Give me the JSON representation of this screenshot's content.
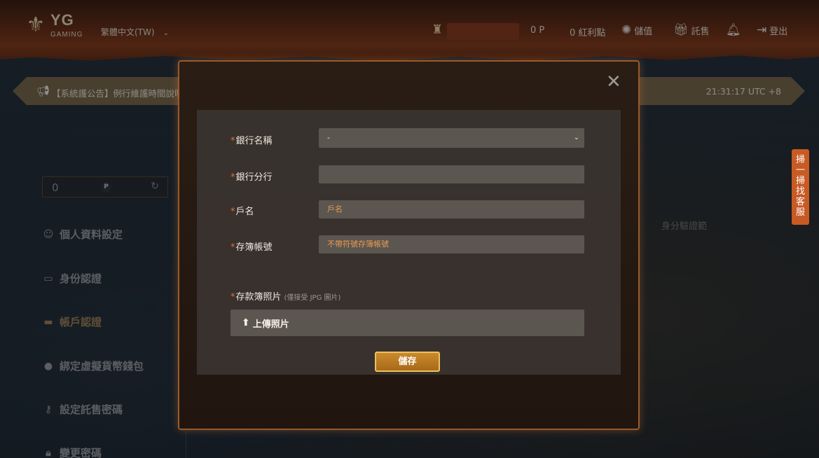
{
  "header": {
    "logo_main": "YG",
    "logo_sub": "GAMING",
    "language": "繁體中文(TW)",
    "points": "0 P",
    "bonus": "0 紅利點",
    "deposit": "儲值",
    "consign": "託售",
    "logout": "登出"
  },
  "banner": {
    "text": "【系統護公告】例行維護時間說明",
    "time": "21:31:17 UTC +8"
  },
  "sidebar": {
    "balance": "0",
    "balance_unit": "P",
    "items": [
      {
        "label": "個人資料設定"
      },
      {
        "label": "身份認證"
      },
      {
        "label": "帳戶認證"
      },
      {
        "label": "綁定虛擬貨幣錢包"
      },
      {
        "label": "設定託售密碼"
      },
      {
        "label": "變更密碼"
      }
    ]
  },
  "customer_service_tab": "掃一掃找客服",
  "background_page": {
    "line1": "身分驗證範"
  },
  "modal": {
    "bank_name_label": "銀行名稱",
    "bank_name_value": "-",
    "bank_branch_label": "銀行分行",
    "bank_branch_value": "",
    "account_name_label": "戶名",
    "account_name_placeholder": "戶名",
    "account_number_label": "存簿帳號",
    "account_number_placeholder": "不帶符號存簿帳號",
    "passbook_photo_label": "存款簿照片",
    "passbook_photo_hint": "(僅接受 JPG 圖片)",
    "upload_label": "上傳照片",
    "save_label": "儲存"
  },
  "colors": {
    "accent": "#c98a2e",
    "required_star": "#d8733a",
    "active_sidebar": "#a8865a"
  }
}
